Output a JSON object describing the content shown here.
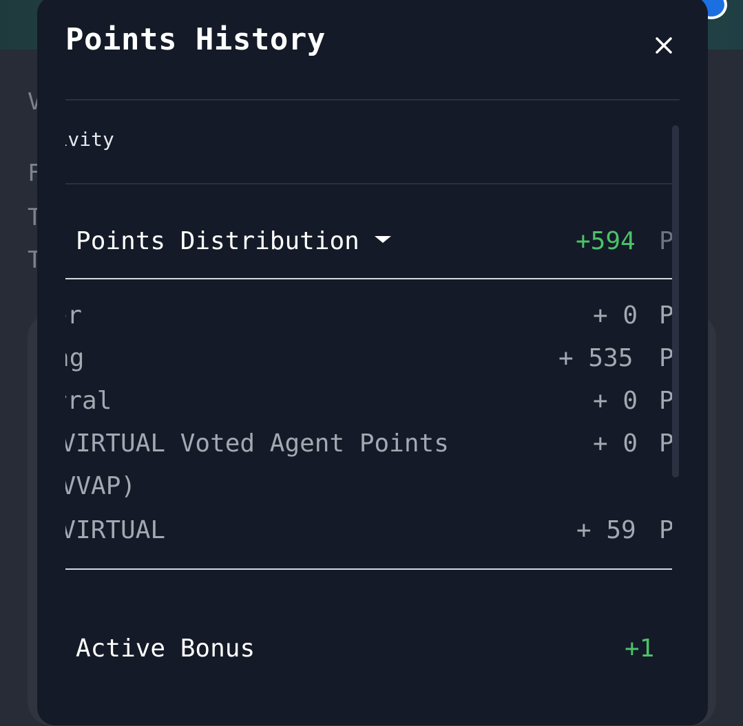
{
  "background": {
    "letters": [
      "V",
      "F",
      "T",
      "T"
    ]
  },
  "modal": {
    "title": "Points History",
    "close_label": "×",
    "activity_tab": "Activity",
    "daily_distribution": {
      "label": "Daily Points Distribution",
      "total": "+594",
      "unit": "Points",
      "items": [
        {
          "label": "Trader",
          "value": "+ 0",
          "unit": "Points"
        },
        {
          "label": "Swapping",
          "value": "+ 535",
          "unit": "Points"
        },
        {
          "label": "Referral",
          "value": "+ 0",
          "unit": "Points"
        },
        {
          "label": "veVIRTUAL Voted Agent Points",
          "label_line2": "(VVAP)",
          "value": "+ 0",
          "unit": "Points"
        },
        {
          "label": "veVIRTUAL",
          "value": "+ 59",
          "unit": "Points"
        }
      ]
    },
    "daily_active_bonus": {
      "label": "Daily Active Bonus",
      "value": "+1"
    }
  },
  "colors": {
    "modal_bg": "#141a27",
    "positive": "#4cc26a",
    "muted_text": "#a4a8b1",
    "divider": "#d6d9df"
  }
}
